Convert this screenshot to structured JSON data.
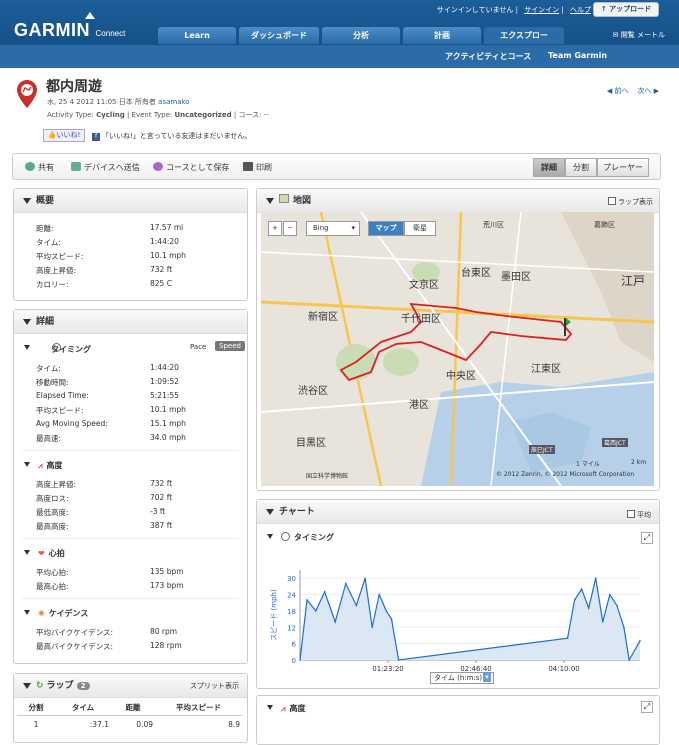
{
  "header": {
    "logo": "GARMIN",
    "logo_sub": "Connect",
    "signin_status": "サインインしていません",
    "signin_link": "サインイン",
    "help_link": "ヘルプ",
    "upload_button": "アップロード",
    "tabs": [
      "Learn",
      "ダッシュボード",
      "分析",
      "計画",
      "エクスプロー"
    ],
    "active_tab": "エクスプロー",
    "mail_link": "開覧 メートル",
    "subnav": [
      "アクティビティとコース",
      "Team Garmin"
    ]
  },
  "activity": {
    "title": "都内周遊",
    "date": "水, 25 4 2012 11:05 日本",
    "owner_label": "所有者",
    "owner": "asamako",
    "type_label": "Activity Type:",
    "type": "Cycling",
    "event_label": "Event Type:",
    "event": "Uncategorized",
    "course_label": "コース:",
    "course": "--",
    "like_button": "いいね!",
    "fb_text": "「いいね!」と言っている友達はまだいません。",
    "prev": "前へ",
    "next": "次へ"
  },
  "toolbar": {
    "share": "共有",
    "send": "デバイスへ送信",
    "save_course": "コースとして保存",
    "print": "印刷",
    "views": [
      "詳細",
      "分割",
      "プレーヤー"
    ],
    "active_view": "詳細"
  },
  "summary": {
    "title": "概要",
    "rows": [
      {
        "label": "距離:",
        "value": "17.57 mi"
      },
      {
        "label": "タイム:",
        "value": "1:44:20"
      },
      {
        "label": "平均スピード:",
        "value": "10.1 mph"
      },
      {
        "label": "高度上昇値:",
        "value": "732 ft"
      },
      {
        "label": "カロリー:",
        "value": "825 C"
      }
    ]
  },
  "details": {
    "title": "詳細",
    "timing": {
      "title": "タイミング",
      "pace_btn": "Pace",
      "speed_btn": "Speed",
      "rows": [
        {
          "label": "タイム:",
          "value": "1:44:20"
        },
        {
          "label": "移動時間:",
          "value": "1:09:52"
        },
        {
          "label": "Elapsed Time:",
          "value": "5:21:55"
        },
        {
          "label": "平均スピード:",
          "value": "10.1 mph"
        },
        {
          "label": "Avg Moving Speed:",
          "value": "15.1 mph"
        },
        {
          "label": "最高速:",
          "value": "34.0 mph"
        }
      ]
    },
    "elevation": {
      "title": "高度",
      "rows": [
        {
          "label": "高度上昇値:",
          "value": "732 ft"
        },
        {
          "label": "高度ロス:",
          "value": "702 ft"
        },
        {
          "label": "最低高度:",
          "value": "-3 ft"
        },
        {
          "label": "最高高度:",
          "value": "387 ft"
        }
      ]
    },
    "heart": {
      "title": "心拍",
      "rows": [
        {
          "label": "平均心拍:",
          "value": "135 bpm"
        },
        {
          "label": "最高心拍:",
          "value": "173 bpm"
        }
      ]
    },
    "cadence": {
      "title": "ケイデンス",
      "rows": [
        {
          "label": "平均バイクケイデンス:",
          "value": "80 rpm"
        },
        {
          "label": "最高バイクケイデンス:",
          "value": "128 rpm"
        }
      ]
    }
  },
  "laps": {
    "title": "ラップ",
    "count": "2",
    "split_link": "スプリット表示",
    "columns": [
      "分割",
      "タイム",
      "距離",
      "平均スピード"
    ],
    "rows": [
      [
        "1",
        ":37.1",
        "0.09",
        "8.9"
      ]
    ]
  },
  "map": {
    "title": "地図",
    "lap_toggle": "ラップ表示",
    "provider": "Bing",
    "modes": [
      "マップ",
      "衛星"
    ],
    "active_mode": "マップ",
    "labels": [
      "荒川区",
      "葛飾区",
      "文京区",
      "台東区",
      "墨田区",
      "江戸",
      "新宿区",
      "千代田区",
      "江東区",
      "渋谷区",
      "中央区",
      "港区",
      "目黒区",
      "国立科学博物館",
      "辰巳JCT",
      "葛西JCT"
    ],
    "scale_top": "1 マイル",
    "scale_bottom": "2 km",
    "copyright": "© 2012 Zenrin, © 2012 Microsoft Corporation",
    "route_color": "#e02020"
  },
  "chart": {
    "title": "チャート",
    "avg_toggle": "平均",
    "timing_title": "タイミング",
    "elevation_title": "高度",
    "x_select": "タイム (h:m:s)"
  },
  "chart_data": {
    "type": "line",
    "ylabel": "スピード (mph)",
    "xlabel": "タイム (h:m:s)",
    "yticks": [
      0,
      6,
      12,
      18,
      24,
      30
    ],
    "xticks": [
      "01:23:20",
      "02:46:40",
      "04:10:00"
    ],
    "ylim": [
      0,
      33
    ],
    "xlim": [
      0,
      19315
    ],
    "series": [
      {
        "x": [
          0,
          400,
          900,
          1400,
          2000,
          2600,
          3200,
          3700,
          4100,
          4500,
          4900,
          5200,
          5600,
          15200,
          15600,
          16000,
          16400,
          16800,
          17200,
          17600,
          18000,
          18400,
          18700,
          19315
        ],
        "values": [
          0,
          22,
          18,
          25,
          14,
          28,
          20,
          30,
          12,
          24,
          18,
          15,
          0,
          8,
          22,
          26,
          19,
          30,
          14,
          24,
          20,
          12,
          0,
          7
        ]
      }
    ],
    "color": "#1a6fd0",
    "fill": "#dbe7f5"
  }
}
